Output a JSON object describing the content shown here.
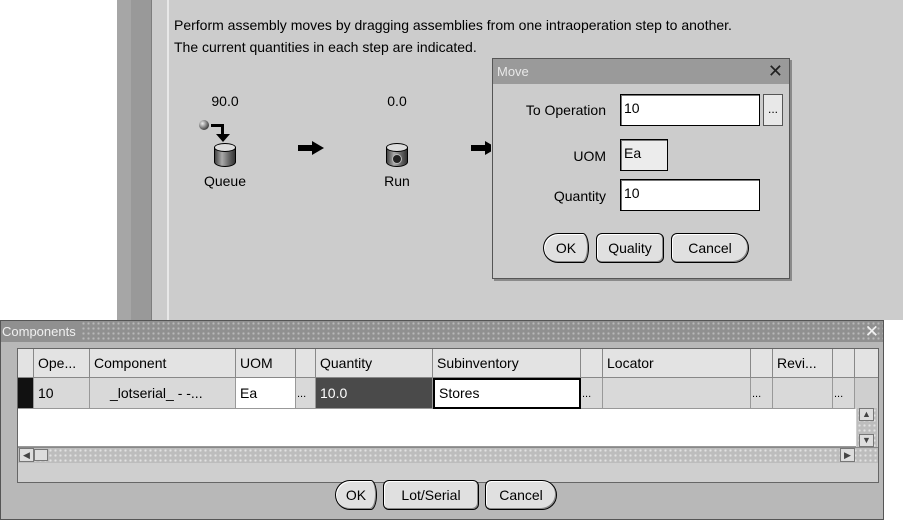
{
  "assembly": {
    "instructions": [
      "Perform assembly moves by dragging assemblies from one intraoperation step to another.",
      "The current quantities in each step are indicated."
    ],
    "steps": [
      {
        "label": "Queue",
        "qty": "90.0"
      },
      {
        "label": "Run",
        "qty": "0.0"
      }
    ]
  },
  "move_dialog": {
    "title": "Move",
    "to_operation_label": "To Operation",
    "to_operation_value": "10",
    "lov_label": "...",
    "uom_label": "UOM",
    "uom_value": "Ea",
    "quantity_label": "Quantity",
    "quantity_value": "10",
    "buttons": {
      "ok": "OK",
      "quality": "Quality",
      "cancel": "Cancel"
    }
  },
  "components": {
    "title": "Components",
    "close": "✕",
    "columns": [
      "Ope...",
      "Component",
      "UOM",
      "Quantity",
      "Subinventory",
      "Locator",
      "Revi..."
    ],
    "row": {
      "operation": "10",
      "component": "_lotserial_ - -...",
      "uom": "Ea",
      "dots": "...",
      "quantity": "10.0",
      "subinventory": "Stores",
      "locator": "",
      "revision": ""
    },
    "buttons": {
      "ok": "OK",
      "lot_serial": "Lot/Serial",
      "cancel": "Cancel"
    }
  }
}
